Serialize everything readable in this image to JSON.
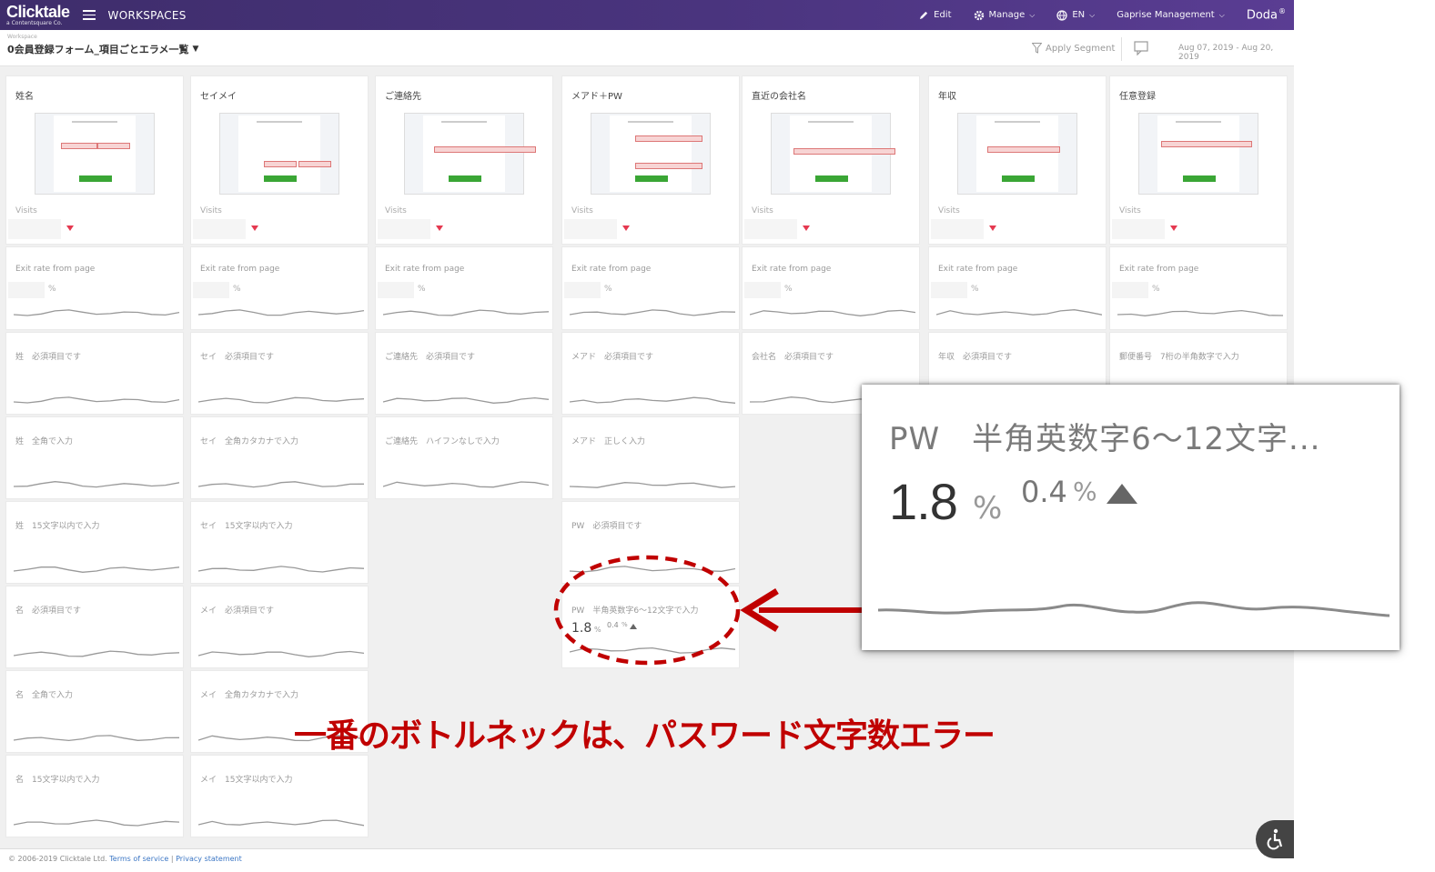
{
  "topbar": {
    "logo": "Clicktale",
    "logo_sub": "a Contentsquare Co.",
    "workspaces": "WORKSPACES",
    "edit": "Edit",
    "manage": "Manage",
    "language": "EN",
    "org": "Gaprise Management",
    "user": "Doda",
    "user_mark": "®"
  },
  "header": {
    "breadcrumb": "Workspace",
    "title": "0会員登録フォーム_項目ごとエラメ一覧",
    "apply_segment": "Apply Segment",
    "date_range": "Aug 07, 2019 - Aug 20, 2019"
  },
  "labels": {
    "visits": "Visits",
    "exit_rate": "Exit rate from page",
    "percent": "%"
  },
  "columns": [
    {
      "title": "姓名",
      "errors": [
        "姓　必須項目です",
        "姓　全角で入力",
        "姓　15文字以内で入力",
        "名　必須項目です",
        "名　全角で入力",
        "名　15文字以内で入力"
      ]
    },
    {
      "title": "セイメイ",
      "errors": [
        "セイ　必須項目です",
        "セイ　全角カタカナで入力",
        "セイ　15文字以内で入力",
        "メイ　必須項目です",
        "メイ　全角カタカナで入力",
        "メイ　15文字以内で入力"
      ]
    },
    {
      "title": "ご連絡先",
      "errors": [
        "ご連絡先　必須項目です",
        "ご連絡先　ハイフンなしで入力"
      ]
    },
    {
      "title": "メアド＋PW",
      "errors": [
        "メアド　必須項目です",
        "メアド　正しく入力",
        "PW　必須項目です",
        "PW　半角英数字6〜12文字で入力"
      ]
    },
    {
      "title": "直近の会社名",
      "errors": [
        "会社名　必須項目です"
      ]
    },
    {
      "title": "年収",
      "errors": [
        "年収　必須項目です"
      ]
    },
    {
      "title": "任意登録",
      "errors": [
        "郵便番号　7桁の半角数字で入力"
      ]
    }
  ],
  "highlight_card": {
    "value": "1.8",
    "unit": "%",
    "change": "0.4",
    "change_unit": "%"
  },
  "callout": {
    "title": "PW　半角英数字6〜12文字...",
    "value": "1.8",
    "unit": "%",
    "change": "0.4",
    "change_unit": "%",
    "trend": "up"
  },
  "annotation": "一番のボトルネックは、パスワード文字数エラー",
  "footer": {
    "copyright": "© 2006-2019 Clicktale Ltd.",
    "terms": "Terms of service",
    "separator": "|",
    "privacy": "Privacy statement"
  },
  "colors": {
    "topbar": "#4a347e",
    "down_indicator": "#e53950",
    "annotation": "#c00000",
    "link": "#3b76c4"
  }
}
